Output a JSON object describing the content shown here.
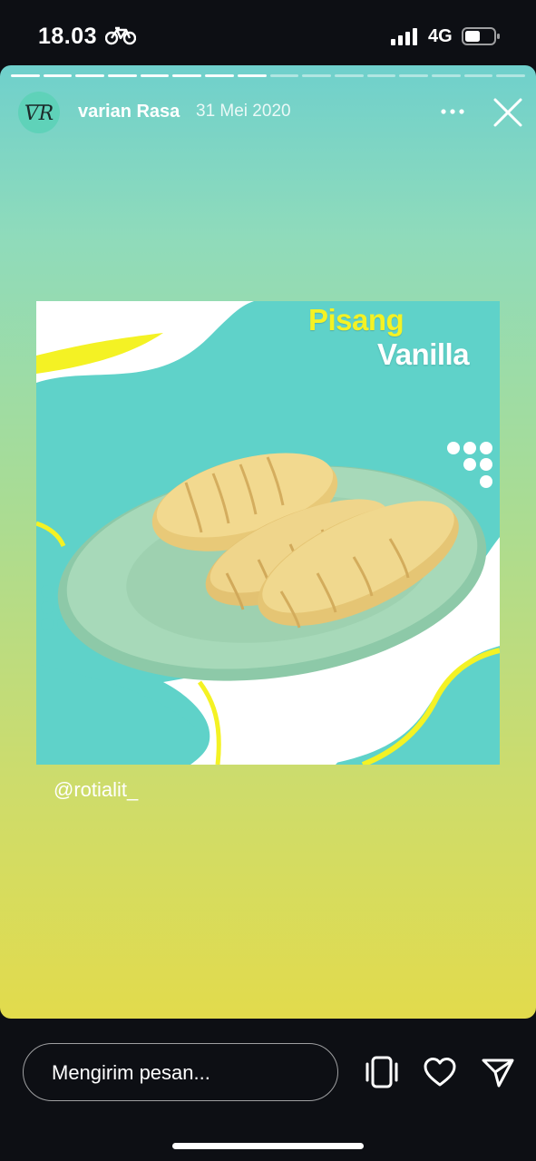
{
  "status_bar": {
    "time": "18.03",
    "network": "4G"
  },
  "story": {
    "progress": {
      "total_segments": 16,
      "completed_segments": 8
    },
    "username": "varian Rasa",
    "date": "31 Mei 2020",
    "post": {
      "title_line1": "Pisang",
      "title_line2": "Vanilla"
    },
    "mention": "@rotialit_"
  },
  "reply_bar": {
    "placeholder": "Mengirim pesan..."
  },
  "colors": {
    "teal": "#5fd2c9",
    "yellow": "#f4f224",
    "plate": "#9fd4b3"
  },
  "icons": [
    "bike-icon",
    "signal-icon",
    "battery-icon",
    "more-icon",
    "close-icon",
    "phone-icon",
    "heart-icon",
    "send-icon"
  ]
}
